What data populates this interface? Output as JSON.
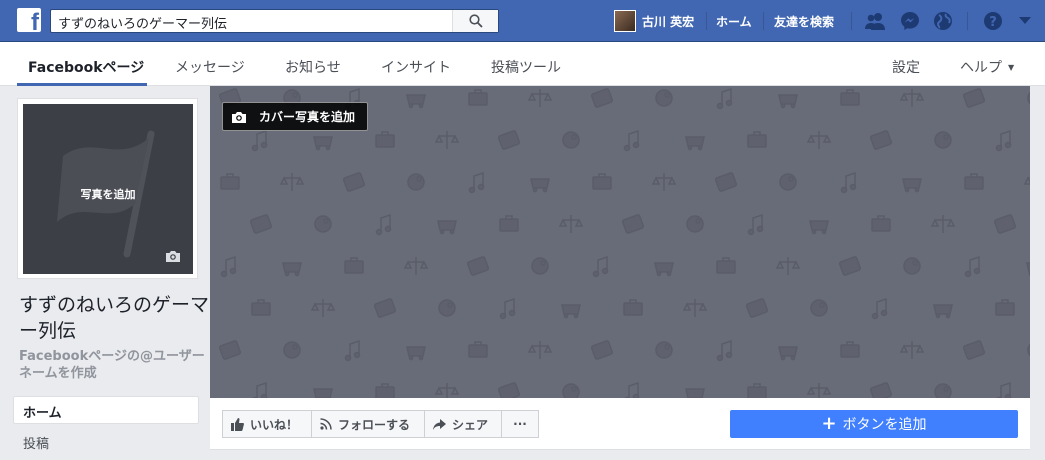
{
  "topbar": {
    "logo": "f",
    "search_value": "すずのねいろのゲーマー列伝",
    "user_name": "古川 英宏",
    "home_label": "ホーム",
    "find_friends_label": "友達を検索"
  },
  "subnav": {
    "items": [
      "Facebookページ",
      "メッセージ",
      "お知らせ",
      "インサイト",
      "投稿ツール"
    ],
    "settings_label": "設定",
    "help_label": "ヘルプ"
  },
  "profile": {
    "add_photo_label": "写真を追加"
  },
  "page": {
    "name": "すずのねいろのゲーマー列伝",
    "username_link": "Facebookページの@ユーザーネームを作成"
  },
  "sidebar": {
    "items": [
      "ホーム",
      "投稿"
    ]
  },
  "cover": {
    "add_cover_label": "カバー写真を追加",
    "background_color": "#686b78"
  },
  "actions": {
    "like_label": "いいね！",
    "follow_label": "フォローする",
    "share_label": "シェア",
    "more_label": "···",
    "add_button_label": "ボタンを追加"
  },
  "colors": {
    "brand_blue": "#4267b2",
    "cta_blue": "#4080ff"
  },
  "icons": [
    "search-icon",
    "friend-requests-icon",
    "messenger-icon",
    "globe-icon",
    "help-icon",
    "account-menu-icon",
    "camera-icon",
    "flag-icon",
    "thumbs-up-icon",
    "rss-icon",
    "share-arrow-icon"
  ]
}
